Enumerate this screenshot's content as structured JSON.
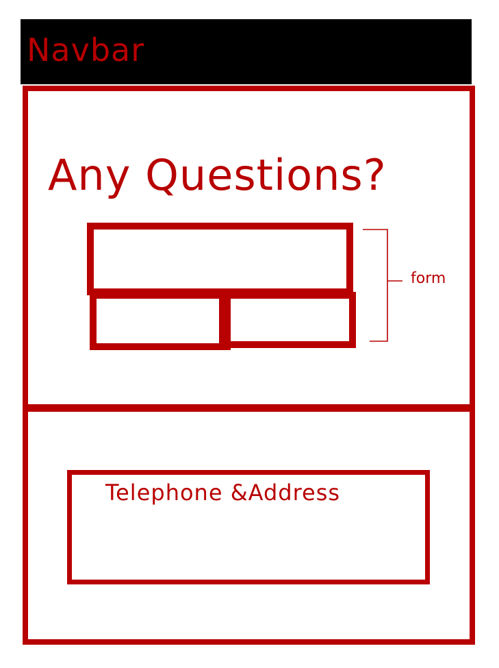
{
  "navbar": {
    "label": "Navbar"
  },
  "hero": {
    "title": "Any Questions?"
  },
  "form": {
    "annotation": "form"
  },
  "contact": {
    "label": "Telephone &Address"
  },
  "colors": {
    "ink": "#b80000",
    "navbar_background": "#000000",
    "page_background": "#ffffff"
  }
}
